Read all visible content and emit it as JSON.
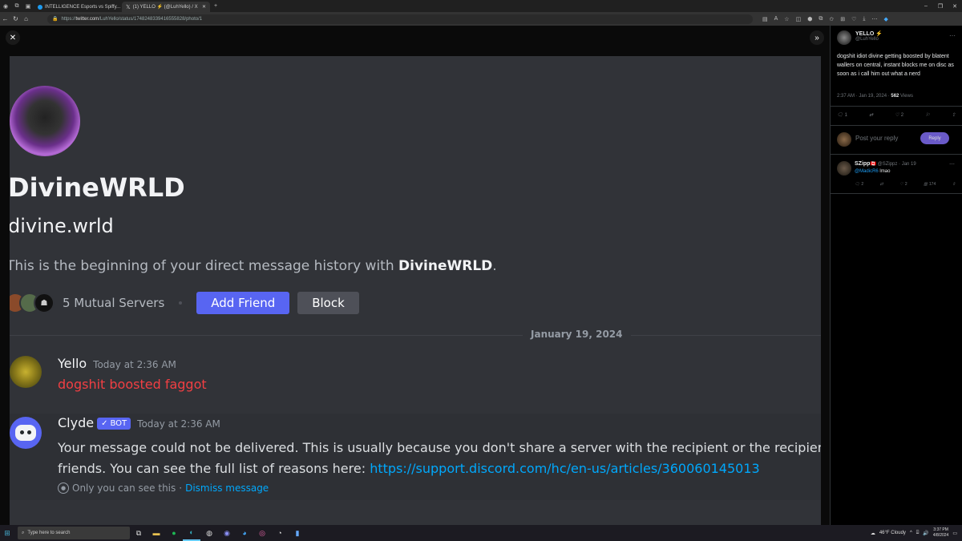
{
  "browser": {
    "tabs": [
      {
        "label": "INTELLIGENCE Esports vs Spiffy..."
      },
      {
        "label": "(1) YELLO ⚡ (@LuhYello) / X"
      }
    ],
    "new_tab": "+",
    "url_prefix": "https://",
    "url_host": "twitter.com",
    "url_path": "/LuhYello/status/1748248339416555828/photo/1"
  },
  "discord": {
    "display_name": "DivineWRLD",
    "username": "divine.wrld",
    "beginning_prefix": "This is the beginning of your direct message history with ",
    "beginning_name": "DivineWRLD",
    "beginning_suffix": ".",
    "mutual_servers": "5 Mutual Servers",
    "add_friend": "Add Friend",
    "block": "Block",
    "date_divider": "January 19, 2024",
    "messages": [
      {
        "author": "Yello",
        "time": "Today at 2:36 AM",
        "text": "dogshit boosted faggot"
      },
      {
        "author": "Clyde",
        "bot_tag": "BOT",
        "time": "Today at 2:36 AM",
        "text": "Your message could not be delivered. This is usually because you don't share a server with the recipient or the recipient is",
        "text2": "friends. You can see the full list of reasons here: ",
        "link": "https://support.discord.com/hc/en-us/articles/360060145013",
        "ephemeral": "Only you can see this",
        "separator": "·",
        "dismiss": "Dismiss message"
      }
    ]
  },
  "overlay_actions": {
    "replies": "1",
    "retweets": "",
    "likes": "2",
    "views": "562"
  },
  "tweet": {
    "author_name": "YELLO ⚡",
    "author_handle": "@LuhYello",
    "text": "dogshit idiot divine getting boosted by blatent wallers on central, instant blocks me on disc as soon as i call him out what a nerd",
    "time": "2:37 AM · Jan 19, 2024 · ",
    "views_count": "562",
    "views_label": " Views",
    "replies": "1",
    "likes": "2",
    "reply_placeholder": "Post your reply",
    "reply_button": "Reply"
  },
  "reply": {
    "name": "SZipp",
    "flag": "🇨🇦",
    "handle": "@SZippz · Jan 19",
    "mention": "@MadicR6",
    "text": " lmao",
    "replies": "2",
    "likes": "2",
    "views": "174"
  },
  "taskbar": {
    "search_placeholder": "Type here to search",
    "weather": "46°F  Cloudy",
    "time": "3:37 PM",
    "date": "4/8/2024"
  }
}
